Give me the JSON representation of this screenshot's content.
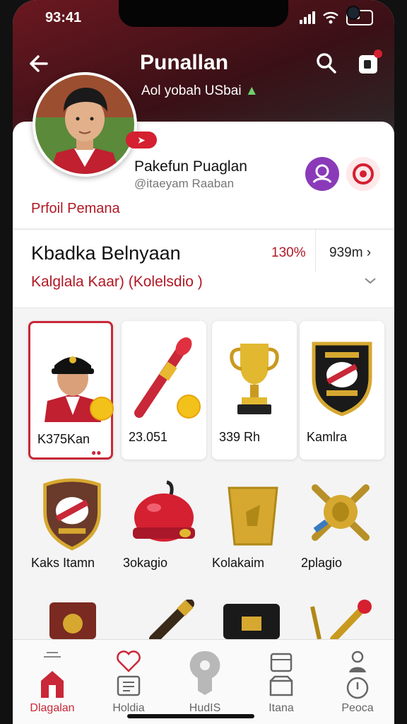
{
  "status": {
    "time": "93:41"
  },
  "header": {
    "title": "Punallan",
    "subtitle": "Aol yobah USbai"
  },
  "profile": {
    "badge": "➤",
    "name": "Pakefun Puaglan",
    "handle": "@itaeyam Raaban",
    "link": "Prfoil Pemana"
  },
  "section": {
    "title": "Kbadka Belnyaan",
    "subtitle": "Kalglala Kaar) (Kolelsdio )",
    "percent": "130%",
    "value": "939m ›"
  },
  "items": [
    {
      "label": "K375Kan",
      "icon": "player-card-icon"
    },
    {
      "label": "23.051",
      "icon": "torch-icon"
    },
    {
      "label": "339 Rh",
      "icon": "trophy-icon"
    },
    {
      "label": "Kamlra",
      "icon": "club-crest-icon"
    },
    {
      "label": "Kaks Itamn",
      "icon": "shield-crest-icon"
    },
    {
      "label": "3okagio",
      "icon": "red-helmet-icon"
    },
    {
      "label": "Kolakaim",
      "icon": "gold-cup-icon"
    },
    {
      "label": "2plagio",
      "icon": "gold-emblem-icon"
    }
  ],
  "nav": [
    {
      "label": "Dlagalan",
      "icon": "home-icon",
      "active": true
    },
    {
      "label": "Holdia",
      "icon": "heart-icon",
      "active": false
    },
    {
      "label": "HudIS",
      "icon": "keyhole-icon",
      "active": false
    },
    {
      "label": "Itana",
      "icon": "box-icon",
      "active": false
    },
    {
      "label": "Peoca",
      "icon": "person-icon",
      "active": false
    }
  ],
  "colors": {
    "accent": "#c82838",
    "brand_dark": "#6b1820"
  }
}
